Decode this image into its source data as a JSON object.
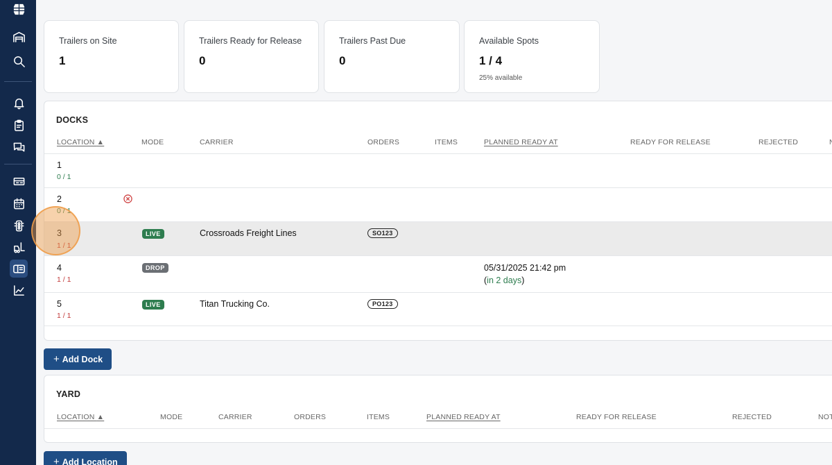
{
  "sidebar": {
    "icons": [
      {
        "name": "logo-icon"
      },
      {
        "name": "warehouse-icon"
      },
      {
        "name": "search-icon"
      },
      {
        "name": "bell-icon"
      },
      {
        "name": "clipboard-icon"
      },
      {
        "name": "chat-icon"
      },
      {
        "name": "ticket-icon"
      },
      {
        "name": "calendar-icon"
      },
      {
        "name": "traffic-light-icon"
      },
      {
        "name": "forklift-icon"
      },
      {
        "name": "yard-map-icon",
        "active": true
      },
      {
        "name": "chart-icon"
      }
    ]
  },
  "stats": [
    {
      "label": "Trailers on Site",
      "value": "1"
    },
    {
      "label": "Trailers Ready for Release",
      "value": "0"
    },
    {
      "label": "Trailers Past Due",
      "value": "0"
    },
    {
      "label": "Available Spots",
      "value": "1 / 4",
      "sub": "25% available"
    }
  ],
  "docks": {
    "title": "DOCKS",
    "columns": {
      "location": "LOCATION",
      "mode": "MODE",
      "carrier": "CARRIER",
      "orders": "ORDERS",
      "items": "ITEMS",
      "planned_ready_at": "PLANNED READY AT",
      "ready_for_release": "READY FOR RELEASE",
      "rejected": "REJECTED",
      "notes": "N"
    },
    "rows": [
      {
        "location": "1",
        "capacity": "0 / 1",
        "mode": "",
        "carrier": "",
        "order": "",
        "planned_ready": "",
        "planned_rel": ""
      },
      {
        "location": "2",
        "capacity": "0 / 1",
        "mode": "",
        "carrier": "",
        "order": "",
        "planned_ready": "",
        "planned_rel": ""
      },
      {
        "location": "3",
        "capacity": "1 / 1",
        "mode": "LIVE",
        "carrier": "Crossroads Freight Lines",
        "order": "SO123",
        "planned_ready": "",
        "planned_rel": ""
      },
      {
        "location": "4",
        "capacity": "1 / 1",
        "mode": "DROP",
        "carrier": "",
        "order": "",
        "planned_ready": "05/31/2025 21:42 pm",
        "planned_rel": "in 2 days"
      },
      {
        "location": "5",
        "capacity": "1 / 1",
        "mode": "LIVE",
        "carrier": "Titan Trucking Co.",
        "order": "PO123",
        "planned_ready": "",
        "planned_rel": ""
      }
    ],
    "add_button": "Add Dock"
  },
  "yard": {
    "title": "YARD",
    "columns": {
      "location": "LOCATION",
      "mode": "MODE",
      "carrier": "CARRIER",
      "orders": "ORDERS",
      "items": "ITEMS",
      "planned_ready_at": "PLANNED READY AT",
      "ready_for_release": "READY FOR RELEASE",
      "rejected": "REJECTED",
      "notes": "NOT"
    },
    "add_button": "Add Location"
  },
  "colors": {
    "sidebar": "#13294b",
    "primary_button": "#1f4e86",
    "live": "#2e7d4f",
    "drop": "#6b6f74",
    "capacity_free": "#2e7d4f",
    "capacity_full": "#c23b3b"
  }
}
